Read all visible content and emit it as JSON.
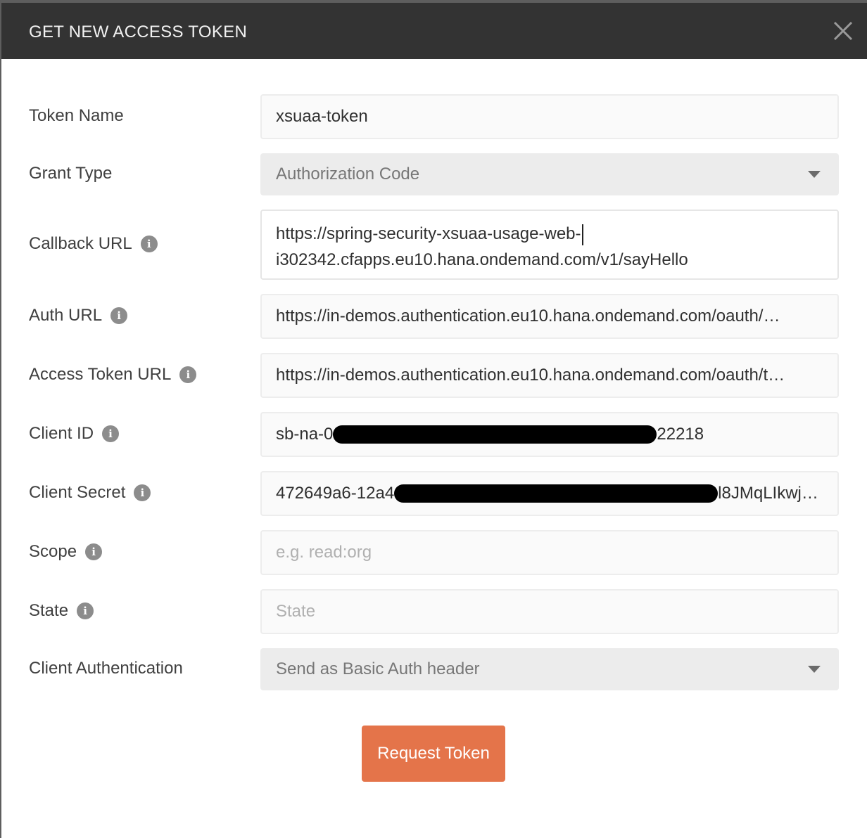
{
  "modal": {
    "title": "GET NEW ACCESS TOKEN",
    "close_icon": "close-icon"
  },
  "fields": {
    "token_name": {
      "label": "Token Name",
      "value": "xsuaa-token"
    },
    "grant_type": {
      "label": "Grant Type",
      "value": "Authorization Code"
    },
    "callback_url": {
      "label": "Callback URL",
      "value_line1": "https://spring-security-xsuaa-usage-web-",
      "value_line2": "i302342.cfapps.eu10.hana.ondemand.com/v1/sayHello"
    },
    "auth_url": {
      "label": "Auth URL",
      "value": "https://in-demos.authentication.eu10.hana.ondemand.com/oauth/…"
    },
    "access_token_url": {
      "label": "Access Token URL",
      "value": "https://in-demos.authentication.eu10.hana.ondemand.com/oauth/t…"
    },
    "client_id": {
      "label": "Client ID",
      "value_prefix": "sb-na-0",
      "value_suffix": "22218"
    },
    "client_secret": {
      "label": "Client Secret",
      "value_prefix": "472649a6-12a4",
      "value_suffix": "l8JMqLIkwj…"
    },
    "scope": {
      "label": "Scope",
      "placeholder": "e.g. read:org"
    },
    "state": {
      "label": "State",
      "placeholder": "State"
    },
    "client_authentication": {
      "label": "Client Authentication",
      "value": "Send as Basic Auth header"
    }
  },
  "actions": {
    "request_token_label": "Request Token"
  },
  "colors": {
    "header_bg": "#333333",
    "accent": "#e4744a"
  }
}
